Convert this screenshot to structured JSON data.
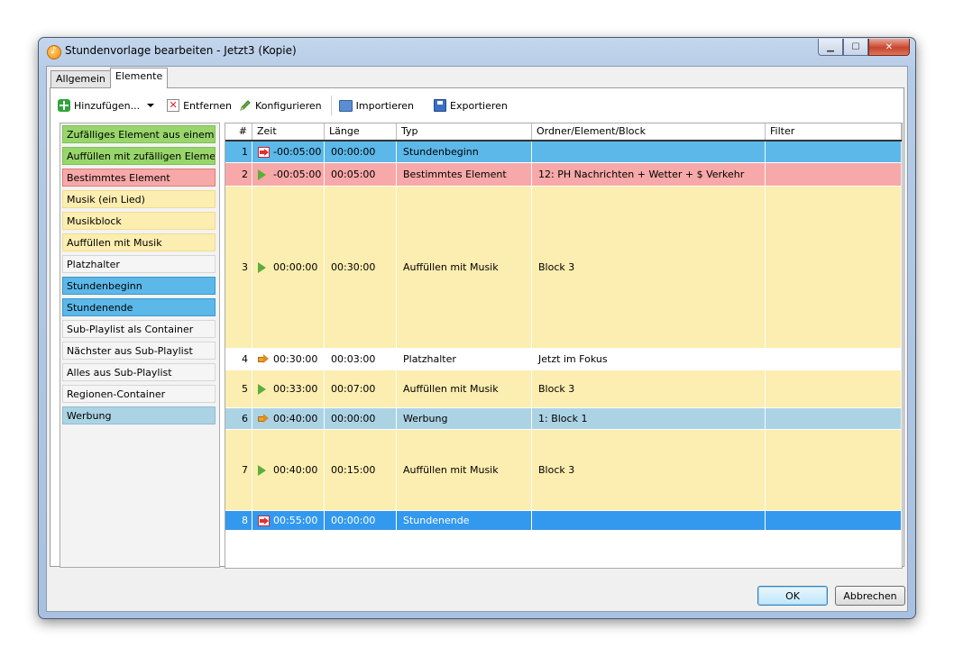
{
  "window": {
    "title": "Stundenvorlage bearbeiten - Jetzt3 (Kopie)",
    "minimize_glyph": "▁",
    "maximize_glyph": "☐",
    "close_glyph": "✕"
  },
  "tabs": [
    {
      "label": "Allgemein",
      "active": false
    },
    {
      "label": "Elemente",
      "active": true
    }
  ],
  "toolbar": {
    "add_label": "Hinzufügen...",
    "remove_label": "Entfernen",
    "configure_label": "Konfigurieren",
    "import_label": "Importieren",
    "export_label": "Exportieren",
    "icons": {
      "add": "add-icon",
      "remove": "remove-icon",
      "configure": "pencil-icon",
      "import": "import-icon",
      "export": "export-icon"
    }
  },
  "palette": [
    {
      "label": "Zufälliges Element aus einem be...",
      "bg": "#98d66b",
      "border": "#7fc055"
    },
    {
      "label": "Auffüllen mit zufälligen Elementen",
      "bg": "#98d66b",
      "border": "#7fc055"
    },
    {
      "label": "Bestimmtes Element",
      "bg": "#f7a8a8",
      "border": "#e07a7a"
    },
    {
      "label": "Musik (ein Lied)",
      "bg": "#fcedb0",
      "border": "#f0dc90"
    },
    {
      "label": "Musikblock",
      "bg": "#fcedb0",
      "border": "#f0dc90"
    },
    {
      "label": "Auffüllen mit Musik",
      "bg": "#fcedb0",
      "border": "#f0dc90"
    },
    {
      "label": "Platzhalter",
      "bg": "#f5f5f5",
      "border": "#d6d6d6"
    },
    {
      "label": "Stundenbeginn",
      "bg": "#5bb8e9",
      "border": "#3a97cc"
    },
    {
      "label": "Stundenende",
      "bg": "#5bb8e9",
      "border": "#3a97cc"
    },
    {
      "label": "Sub-Playlist als Container",
      "bg": "#f5f5f5",
      "border": "#d6d6d6"
    },
    {
      "label": "Nächster aus Sub-Playlist",
      "bg": "#f5f5f5",
      "border": "#d6d6d6"
    },
    {
      "label": "Alles aus Sub-Playlist",
      "bg": "#f5f5f5",
      "border": "#d6d6d6"
    },
    {
      "label": "Regionen-Container",
      "bg": "#f5f5f5",
      "border": "#d6d6d6"
    },
    {
      "label": "Werbung",
      "bg": "#acd3e4",
      "border": "#8dbdd3"
    }
  ],
  "grid": {
    "columns": [
      "#",
      "Zeit",
      "Länge",
      "Typ",
      "Ordner/Element/Block",
      "Filter"
    ],
    "rows": [
      {
        "num": "1",
        "icon": "hour-start-icon",
        "zeit": "-00:05:00",
        "laenge": "00:00:00",
        "typ": "Stundenbeginn",
        "ordner": "",
        "filter": "",
        "bg": "#5bb8e9",
        "color": "#000"
      },
      {
        "num": "2",
        "icon": "play-green-icon",
        "zeit": "-00:05:00",
        "laenge": "00:05:00",
        "typ": "Bestimmtes Element",
        "ordner": "12: PH Nachrichten + Wetter + $ Verkehr",
        "filter": "",
        "bg": "#f7a8a8",
        "color": "#000"
      },
      {
        "num": "3",
        "icon": "play-green-icon",
        "zeit": "00:00:00",
        "laenge": "00:30:00",
        "typ": "Auffüllen mit Musik",
        "ordner": "Block 3",
        "filter": "",
        "bg": "#fcedb0",
        "color": "#000"
      },
      {
        "num": "4",
        "icon": "arrow-orange-icon",
        "zeit": "00:30:00",
        "laenge": "00:03:00",
        "typ": "Platzhalter",
        "ordner": "Jetzt im Fokus",
        "filter": "",
        "bg": "#ffffff",
        "color": "#000"
      },
      {
        "num": "5",
        "icon": "play-green-icon",
        "zeit": "00:33:00",
        "laenge": "00:07:00",
        "typ": "Auffüllen mit Musik",
        "ordner": "Block 3",
        "filter": "",
        "bg": "#fcedb0",
        "color": "#000"
      },
      {
        "num": "6",
        "icon": "arrow-orange-icon",
        "zeit": "00:40:00",
        "laenge": "00:00:00",
        "typ": "Werbung",
        "ordner": "1: Block 1",
        "filter": "",
        "bg": "#acd3e4",
        "color": "#000"
      },
      {
        "num": "7",
        "icon": "play-green-icon",
        "zeit": "00:40:00",
        "laenge": "00:15:00",
        "typ": "Auffüllen mit Musik",
        "ordner": "Block 3",
        "filter": "",
        "bg": "#fcedb0",
        "color": "#000"
      },
      {
        "num": "8",
        "icon": "hour-end-icon",
        "zeit": "00:55:00",
        "laenge": "00:00:00",
        "typ": "Stundenende",
        "ordner": "",
        "filter": "",
        "bg": "#3399ee",
        "color": "#ffffff",
        "selected": true
      }
    ]
  },
  "buttons": {
    "ok_label": "OK",
    "cancel_label": "Abbrechen"
  }
}
